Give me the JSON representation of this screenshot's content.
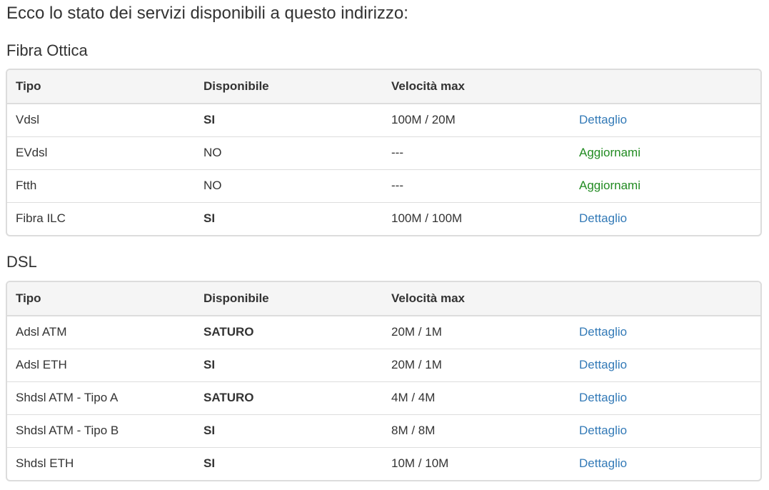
{
  "intro": "Ecco lo stato dei servizi disponibili a questo indirizzo:",
  "fibra": {
    "title": "Fibra Ottica",
    "headers": [
      "Tipo",
      "Disponibile",
      "Velocità max",
      ""
    ],
    "rows": [
      {
        "tipo": "Vdsl",
        "disponibile": "SI",
        "velocita": "100M / 20M",
        "azione": "Dettaglio",
        "azione_tipo": "dettaglio"
      },
      {
        "tipo": "EVdsl",
        "disponibile": "NO",
        "velocita": "---",
        "azione": "Aggiornami",
        "azione_tipo": "aggiornami"
      },
      {
        "tipo": "Ftth",
        "disponibile": "NO",
        "velocita": "---",
        "azione": "Aggiornami",
        "azione_tipo": "aggiornami"
      },
      {
        "tipo": "Fibra ILC",
        "disponibile": "SI",
        "velocita": "100M / 100M",
        "azione": "Dettaglio",
        "azione_tipo": "dettaglio"
      }
    ]
  },
  "dsl": {
    "title": "DSL",
    "headers": [
      "Tipo",
      "Disponibile",
      "Velocità max",
      ""
    ],
    "rows": [
      {
        "tipo": "Adsl ATM",
        "disponibile": "SATURO",
        "velocita": "20M / 1M",
        "azione": "Dettaglio",
        "azione_tipo": "dettaglio"
      },
      {
        "tipo": "Adsl ETH",
        "disponibile": "SI",
        "velocita": "20M / 1M",
        "azione": "Dettaglio",
        "azione_tipo": "dettaglio"
      },
      {
        "tipo": "Shdsl ATM - Tipo A",
        "disponibile": "SATURO",
        "velocita": "4M / 4M",
        "azione": "Dettaglio",
        "azione_tipo": "dettaglio"
      },
      {
        "tipo": "Shdsl ATM - Tipo B",
        "disponibile": "SI",
        "velocita": "8M / 8M",
        "azione": "Dettaglio",
        "azione_tipo": "dettaglio"
      },
      {
        "tipo": "Shdsl ETH",
        "disponibile": "SI",
        "velocita": "10M / 10M",
        "azione": "Dettaglio",
        "azione_tipo": "dettaglio"
      }
    ]
  },
  "colors": {
    "link": "#337ab7",
    "upgrade": "#228b22",
    "text": "#333333",
    "header_bg": "#f5f5f5",
    "border": "#dddddd"
  }
}
